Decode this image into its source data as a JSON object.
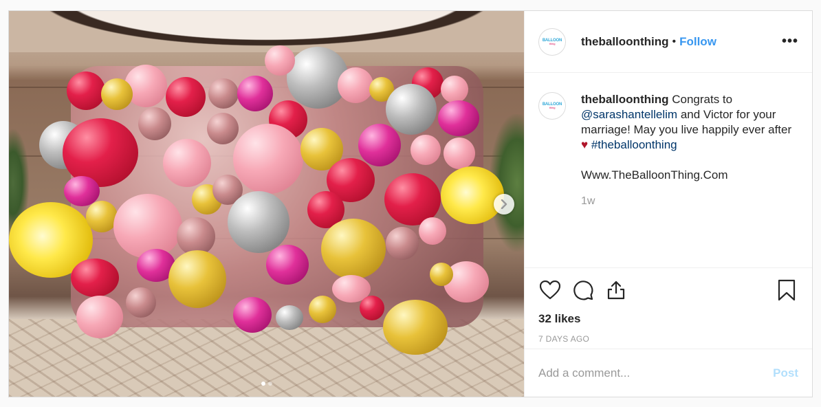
{
  "post": {
    "username": "theballoonthing",
    "separator": "•",
    "follow_label": "Follow",
    "more_label": "•••",
    "avatar_text_top": "BALLOON",
    "avatar_text_bottom": "thing",
    "caption": {
      "username": "theballoonthing",
      "text_1": "Congrats to",
      "mention": "@sarashantellelim",
      "text_2": "and Victor for your marriage! May you live happily ever after",
      "heart": "♥",
      "hashtag": "#theballoonthing",
      "link": "Www.TheBalloonThing.Com",
      "time_ago": "1w"
    },
    "likes": "32 likes",
    "date": "7 DAYS AGO",
    "comment_placeholder": "Add a comment...",
    "post_label": "Post",
    "carousel": {
      "total": 2,
      "active_index": 0
    }
  },
  "icons": {
    "like": "heart-icon",
    "comment": "comment-icon",
    "share": "share-icon",
    "save": "bookmark-icon",
    "next": "chevron-right-icon"
  },
  "colors": {
    "follow": "#3897f0",
    "link": "#003569",
    "post_disabled": "#b2dffc",
    "muted": "#999999"
  }
}
